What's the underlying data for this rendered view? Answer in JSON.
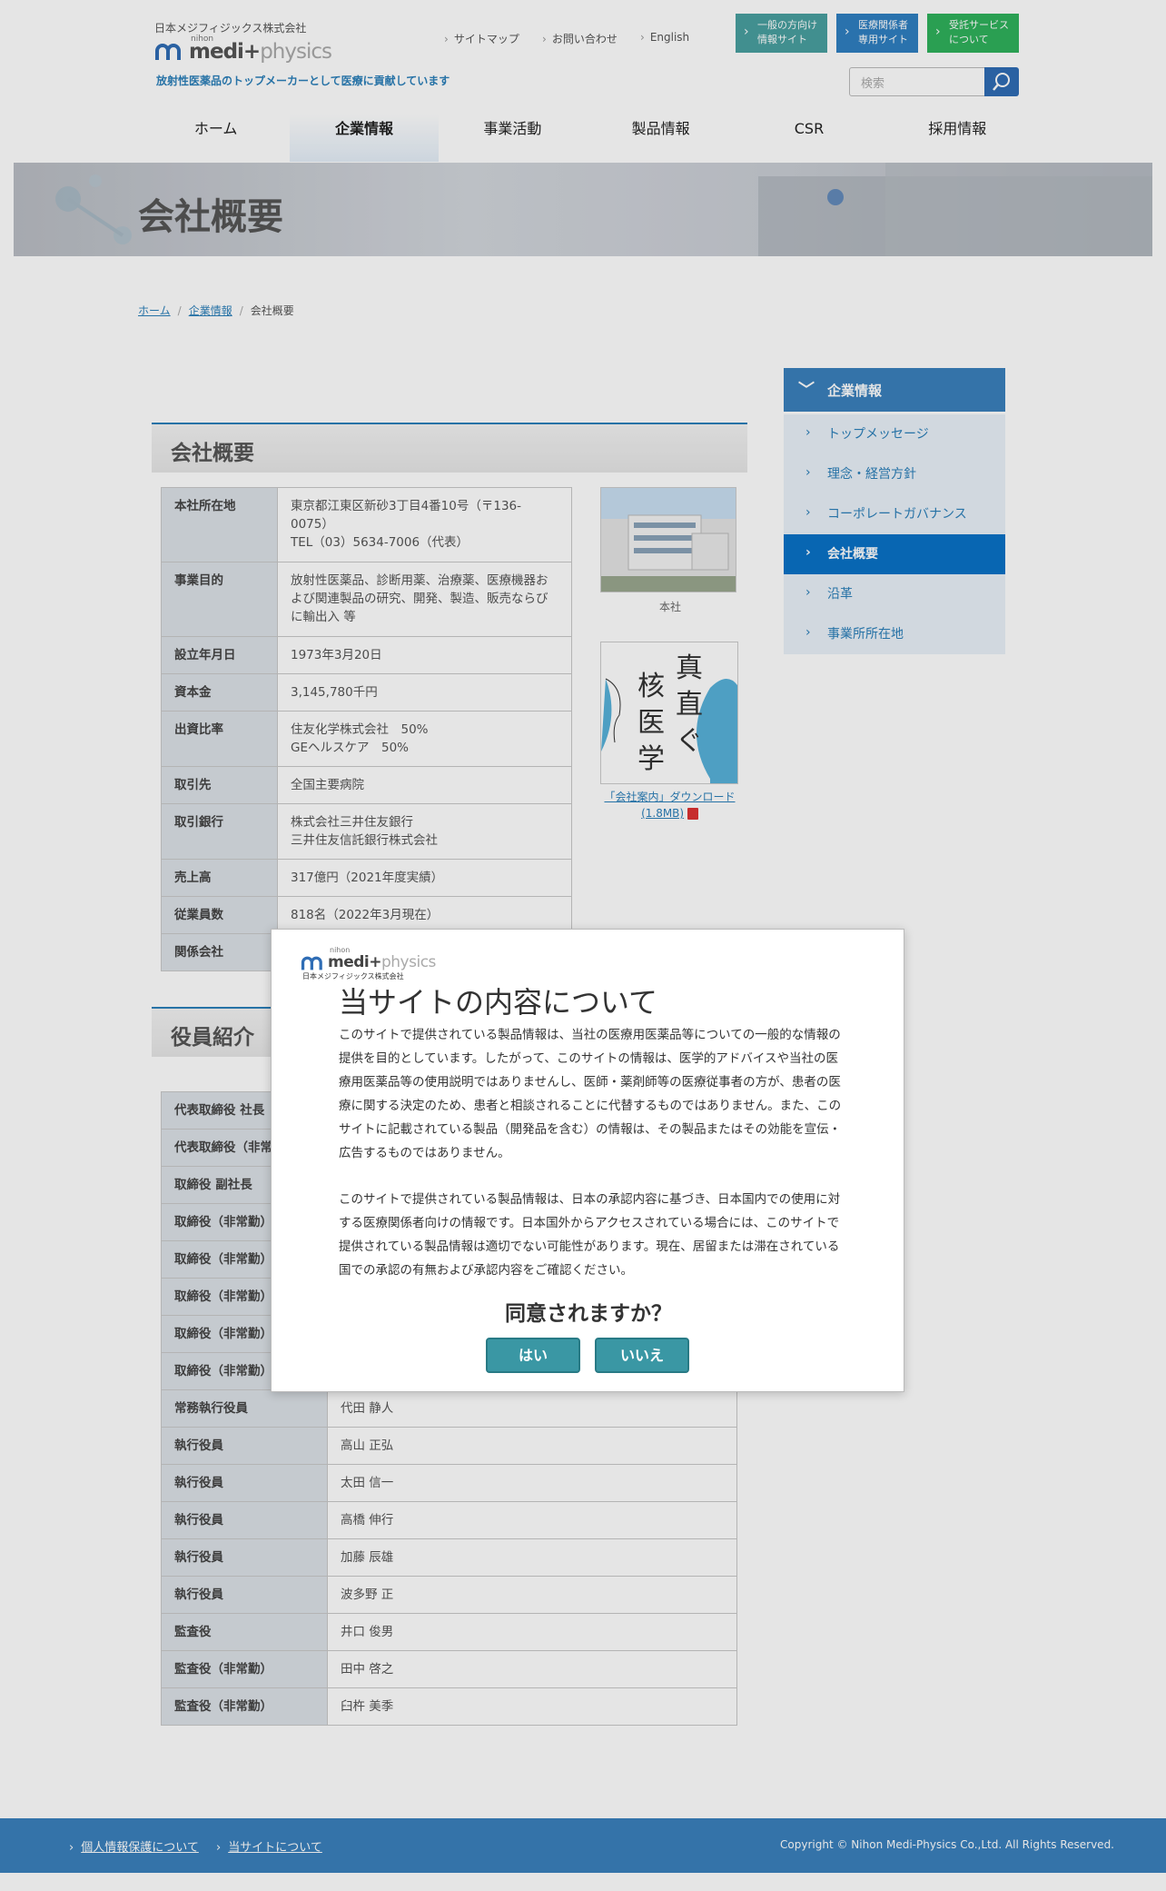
{
  "header": {
    "company_name": "日本メジフィジックス株式会社",
    "logo_nihon": "nihon",
    "logo_medi": "medi+",
    "logo_physics": "physics",
    "tagline": "放射性医薬品のトップメーカーとして医療に貢献しています",
    "links": [
      "サイトマップ",
      "お問い合わせ",
      "English"
    ],
    "buttons": [
      {
        "line1": "一般の方向け",
        "line2": "情報サイト",
        "color": "#49a0a0"
      },
      {
        "line1": "医療関係者",
        "line2": "専用サイト",
        "color": "#2f7fc1"
      },
      {
        "line1": "受託サービス",
        "line2": "について",
        "color": "#2fb15c"
      }
    ],
    "search_placeholder": "検索"
  },
  "gnav": [
    "ホーム",
    "企業情報",
    "事業活動",
    "製品情報",
    "CSR",
    "採用情報"
  ],
  "banner_title": "会社概要",
  "breadcrumb": [
    "ホーム",
    "企業情報",
    "会社概要"
  ],
  "profile": {
    "heading": "会社概要",
    "rows": [
      {
        "label": "本社所在地",
        "value": "東京都江東区新砂3丁目4番10号（〒136-0075）\nTEL（03）5634-7006（代表）"
      },
      {
        "label": "事業目的",
        "value": "放射性医薬品、診断用薬、治療薬、医療機器および関連製品の研究、開発、製造、販売ならびに輸出入 等"
      },
      {
        "label": "設立年月日",
        "value": "1973年3月20日"
      },
      {
        "label": "資本金",
        "value": "3,145,780千円"
      },
      {
        "label": "出資比率",
        "value": "住友化学株式会社　50%\nGEヘルスケア　50%"
      },
      {
        "label": "取引先",
        "value": "全国主要病院"
      },
      {
        "label": "取引銀行",
        "value": "株式会社三井住友銀行\n三井住友信託銀行株式会社"
      },
      {
        "label": "売上高",
        "value": "317億円（2021年度実績）"
      },
      {
        "label": "従業員数",
        "value": "818名（2022年3月現在）"
      },
      {
        "label": "関係会社",
        "value": ""
      }
    ],
    "photo_caption": "本社",
    "brochure_chars": [
      "真",
      "直",
      "ぐ",
      "核",
      "医",
      "学"
    ],
    "brochure_link": "「会社案内」ダウンロード",
    "brochure_size": "(1.8MB)"
  },
  "sidenav": {
    "title": "企業情報",
    "items": [
      "トップメッセージ",
      "理念・経営方針",
      "コーポレートガバナンス",
      "会社概要",
      "沿革",
      "事業所所在地"
    ],
    "active_index": 3
  },
  "officers": {
    "heading": "役員紹介",
    "rows": [
      {
        "title": "代表取締役 社長",
        "name": ""
      },
      {
        "title": "代表取締役（非常勤）",
        "name": ""
      },
      {
        "title": "取締役 副社長",
        "name": ""
      },
      {
        "title": "取締役（非常勤）",
        "name": ""
      },
      {
        "title": "取締役（非常勤）",
        "name": ""
      },
      {
        "title": "取締役（非常勤）",
        "name": ""
      },
      {
        "title": "取締役（非常勤）",
        "name": ""
      },
      {
        "title": "取締役（非常勤）",
        "name": ""
      },
      {
        "title": "常務執行役員",
        "name": "代田 静人"
      },
      {
        "title": "執行役員",
        "name": "高山 正弘"
      },
      {
        "title": "執行役員",
        "name": "太田 信一"
      },
      {
        "title": "執行役員",
        "name": "高橋 伸行"
      },
      {
        "title": "執行役員",
        "name": "加藤 辰雄"
      },
      {
        "title": "執行役員",
        "name": "波多野 正"
      },
      {
        "title": "監査役",
        "name": "井口 俊男"
      },
      {
        "title": "監査役（非常勤）",
        "name": "田中 啓之"
      },
      {
        "title": "監査役（非常勤）",
        "name": "臼杵 美季"
      }
    ]
  },
  "modal": {
    "logo_nihon": "nihon",
    "logo_medi": "medi+",
    "logo_physics": "physics",
    "logo_sub": "日本メジフィジックス株式会社",
    "title": "当サイトの内容について",
    "para1": "このサイトで提供されている製品情報は、当社の医療用医薬品等についての一般的な情報の提供を目的としています。したがって、このサイトの情報は、医学的アドバイスや当社の医療用医薬品等の使用説明ではありませんし、医師・薬剤師等の医療従事者の方が、患者の医療に関する決定のため、患者と相談されることに代替するものではありません。また、このサイトに記載されている製品（開発品を含む）の情報は、その製品またはその効能を宣伝・広告するものではありません。",
    "para2": "このサイトで提供されている製品情報は、日本の承認内容に基づき、日本国内での使用に対する医療関係者向けの情報です。日本国外からアクセスされている場合には、このサイトで提供されている製品情報は適切でない可能性があります。現在、居留または滞在されている国での承認の有無および承認内容をご確認ください。",
    "question": "同意されますか？",
    "yes": "はい",
    "no": "いいえ"
  },
  "footer": {
    "links": [
      "個人情報保護について",
      "当サイトについて"
    ],
    "copyright": "Copyright © Nihon Medi-Physics Co.,Ltd. All Rights Reserved."
  }
}
